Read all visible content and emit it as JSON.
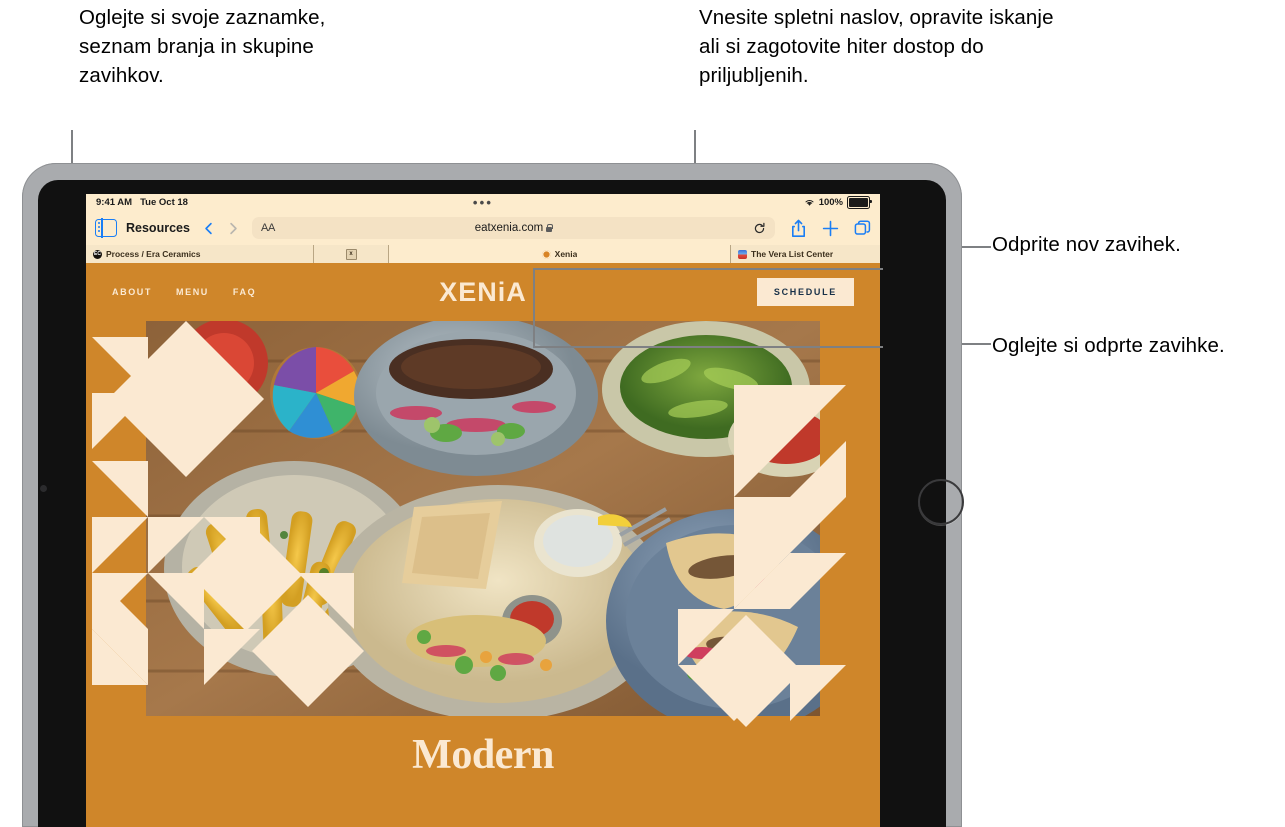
{
  "callouts": {
    "sidebar": "Oglejte si svoje zaznamke, seznam branja in skupine zavihkov.",
    "address": "Vnesite spletni naslov, opravite iskanje ali si zagotovite hiter dostop do priljubljenih.",
    "new_tab": "Odprite nov zavihek.",
    "show_tabs": "Oglejte si odprte zavihke."
  },
  "status_bar": {
    "time": "9:41 AM",
    "date": "Tue Oct 18",
    "center_dots": "•••",
    "wifi_icon": "wifi-icon",
    "battery_percent": "100%",
    "battery_icon": "battery-icon"
  },
  "toolbar": {
    "sidebar_icon": "sidebar-icon",
    "title": "Resources",
    "back_icon": "chevron-left-icon",
    "forward_icon": "chevron-right-icon",
    "text_size_label": "AA",
    "url": "eatxenia.com",
    "lock_icon": "lock-icon",
    "reload_icon": "reload-icon",
    "share_icon": "share-icon",
    "new_tab_icon": "plus-icon",
    "show_tabs_icon": "tabs-icon"
  },
  "tabs": [
    {
      "title": "Process / Era Ceramics",
      "favicon": "ec-favicon",
      "active": false
    },
    {
      "title": "",
      "favicon": "x-favicon",
      "active": false
    },
    {
      "title": "Xenia",
      "favicon": "xenia-favicon",
      "active": true
    },
    {
      "title": "The Vera List Center",
      "favicon": "vera-favicon",
      "active": false
    }
  ],
  "site": {
    "nav": [
      "ABOUT",
      "MENU",
      "FAQ"
    ],
    "logo": "XENiA",
    "schedule_label": "SCHEDULE",
    "headline": "Modern",
    "colors": {
      "brand_orange": "#cf862a",
      "cream": "#fbe9d2",
      "navy": "#173048"
    }
  }
}
